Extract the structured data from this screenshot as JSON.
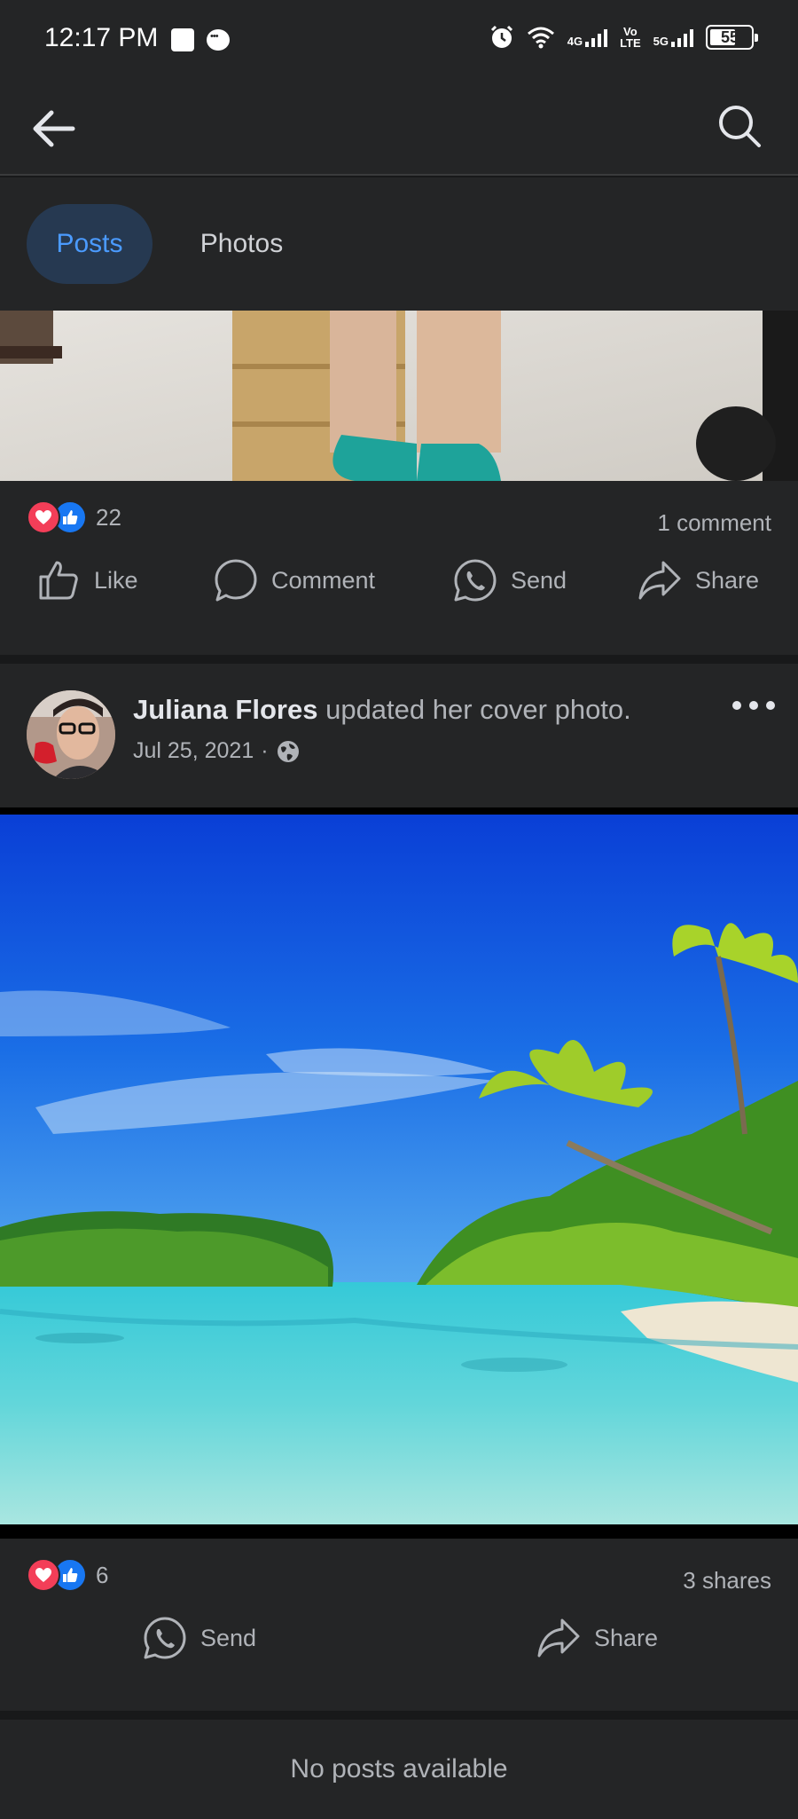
{
  "status_bar": {
    "time": "12:17 PM",
    "network_4g": "4G",
    "network_volte_top": "Vo",
    "network_volte_bottom": "LTE",
    "network_5g": "5G",
    "battery": "55"
  },
  "tabs": [
    {
      "label": "Posts",
      "selected": true
    },
    {
      "label": "Photos",
      "selected": false
    }
  ],
  "post1": {
    "reaction_count": "22",
    "comments": "1 comment",
    "actions": {
      "like": "Like",
      "comment": "Comment",
      "send": "Send",
      "share": "Share"
    }
  },
  "post2": {
    "author": "Juliana Flores",
    "activity": " updated her cover photo.",
    "date": "Jul 25, 2021",
    "separator": "·",
    "reaction_count": "6",
    "shares": "3 shares",
    "actions": {
      "send": "Send",
      "share": "Share"
    }
  },
  "footer_message": "No posts available",
  "colors": {
    "background": "#18191a",
    "surface": "#242526",
    "accent": "#4b9bff",
    "heart": "#f33e58",
    "like": "#1877f2"
  }
}
